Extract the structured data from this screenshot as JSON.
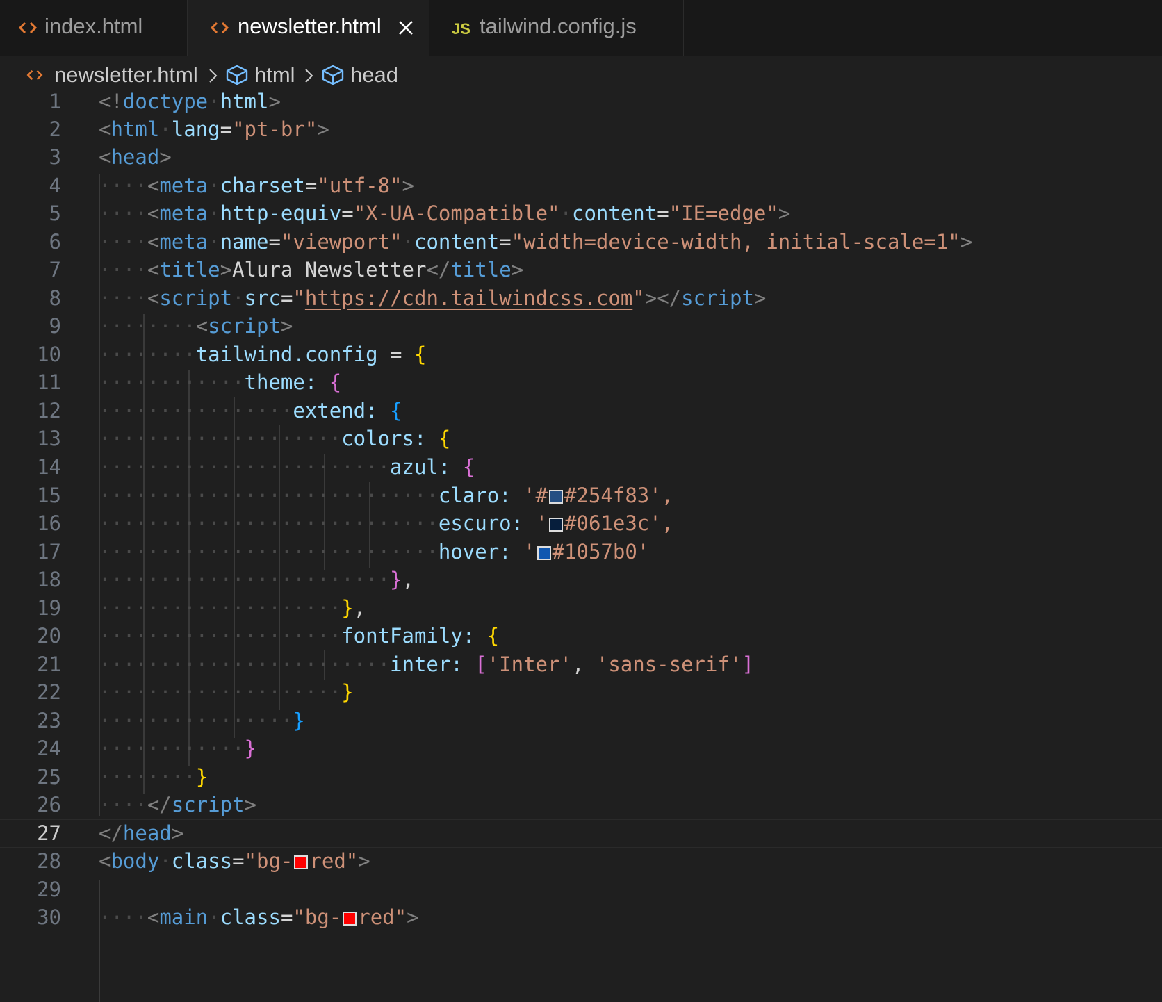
{
  "tabs": [
    {
      "label": "index.html",
      "icon": "html-code-icon",
      "active": false
    },
    {
      "label": "newsletter.html",
      "icon": "html-code-icon",
      "active": true
    },
    {
      "label": "tailwind.config.js",
      "icon": "js-file-icon",
      "icon_text": "JS",
      "active": false
    }
  ],
  "breadcrumb": [
    {
      "label": "newsletter.html",
      "icon": "html-code-icon"
    },
    {
      "label": "html",
      "icon": "cube-icon"
    },
    {
      "label": "head",
      "icon": "cube-icon"
    }
  ],
  "editor": {
    "current_line": 27,
    "line_numbers": [
      "1",
      "2",
      "3",
      "4",
      "5",
      "6",
      "7",
      "8",
      "9",
      "10",
      "11",
      "12",
      "13",
      "14",
      "15",
      "16",
      "17",
      "18",
      "19",
      "20",
      "21",
      "22",
      "23",
      "24",
      "25",
      "26",
      "27",
      "28",
      "29",
      "30"
    ],
    "colors": {
      "azul_claro": "#254f83",
      "azul_escuro": "#061e3c",
      "azul_hover": "#1057b0",
      "red": "#ff0000"
    },
    "lines": {
      "l1": [
        "<!",
        "doctype",
        " ",
        "html",
        ">"
      ],
      "l2": [
        "<",
        "html",
        " ",
        "lang",
        "=",
        "\"pt-br\"",
        ">"
      ],
      "l3": [
        "<",
        "head",
        ">"
      ],
      "l4": [
        "····",
        "<",
        "meta",
        " ",
        "charset",
        "=",
        "\"utf-8\"",
        ">"
      ],
      "l5": [
        "····",
        "<",
        "meta",
        " ",
        "http-equiv",
        "=",
        "\"X-UA-Compatible\"",
        " ",
        "content",
        "=",
        "\"IE=edge\"",
        ">"
      ],
      "l6": [
        "····",
        "<",
        "meta",
        " ",
        "name",
        "=",
        "\"viewport\"",
        " ",
        "content",
        "=",
        "\"width=device-width, initial-scale=1\"",
        ">"
      ],
      "l7": [
        "····",
        "<",
        "title",
        ">",
        "Alura Newsletter",
        "</",
        "title",
        ">"
      ],
      "l8": [
        "····",
        "<",
        "script",
        " ",
        "src",
        "=",
        "\"",
        "https://cdn.tailwindcss.com",
        "\"",
        "></",
        "script",
        ">"
      ],
      "l9": [
        "········",
        "<",
        "script",
        ">"
      ],
      "l10": [
        "········",
        "tailwind.config",
        " = ",
        "{"
      ],
      "l11": [
        "············",
        "theme: ",
        "{"
      ],
      "l12": [
        "················",
        "extend: ",
        "{"
      ],
      "l13": [
        "····················",
        "colors: ",
        "{"
      ],
      "l14": [
        "························",
        "azul: ",
        "{"
      ],
      "l15": [
        "····························",
        "claro: ",
        "'#",
        "#254f83",
        "',"
      ],
      "l16": [
        "····························",
        "escuro: ",
        "'",
        "#061e3c",
        "',"
      ],
      "l17": [
        "····························",
        "hover: ",
        "'",
        "#1057b0",
        "'"
      ],
      "l18": [
        "························",
        "}",
        ","
      ],
      "l19": [
        "····················",
        "}",
        ","
      ],
      "l20": [
        "····················",
        "fontFamily: ",
        "{"
      ],
      "l21": [
        "························",
        "inter: ",
        "[",
        "'Inter'",
        ", ",
        "'sans-serif'",
        "]"
      ],
      "l22": [
        "····················",
        "}"
      ],
      "l23": [
        "················",
        "}"
      ],
      "l24": [
        "············",
        "}"
      ],
      "l25": [
        "········",
        "}"
      ],
      "l26": [
        "····",
        "</",
        "script",
        ">"
      ],
      "l27": [
        "</",
        "head",
        ">"
      ],
      "l28": [
        "<",
        "body",
        " ",
        "class",
        "=",
        "\"bg-",
        "red\"",
        ">"
      ],
      "l29": [],
      "l30": [
        "····",
        "<",
        "main",
        " ",
        "class",
        "=",
        "\"bg-",
        "red\"",
        ">"
      ]
    }
  }
}
